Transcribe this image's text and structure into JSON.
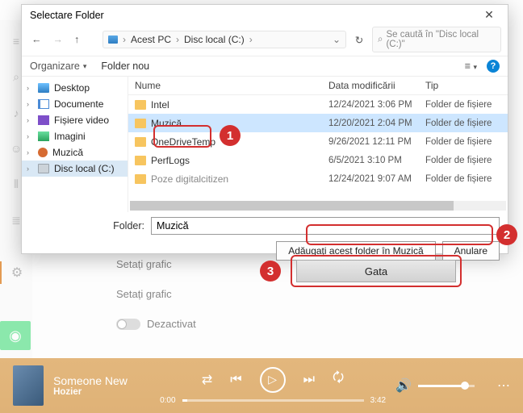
{
  "dialog": {
    "title": "Selectare Folder",
    "nav": {
      "path": {
        "seg1": "Acest PC",
        "seg2": "Disc local (C:)"
      },
      "search_placeholder": "Se caută în \"Disc local (C:)\""
    },
    "toolbar": {
      "organize": "Organizare",
      "newfolder": "Folder nou"
    },
    "tree": {
      "desktop": "Desktop",
      "documents": "Documente",
      "video": "Fișiere video",
      "images": "Imagini",
      "music": "Muzică",
      "disk": "Disc local (C:)"
    },
    "columns": {
      "name": "Nume",
      "date": "Data modificării",
      "type": "Tip"
    },
    "rows": [
      {
        "name": "Intel",
        "date": "12/24/2021 3:06 PM",
        "type": "Folder de fișiere",
        "sel": false,
        "cut": false
      },
      {
        "name": "Muzică",
        "date": "12/20/2021 2:04 PM",
        "type": "Folder de fișiere",
        "sel": true,
        "cut": false
      },
      {
        "name": "OneDriveTemp",
        "date": "9/26/2021 12:11 PM",
        "type": "Folder de fișiere",
        "sel": false,
        "cut": false
      },
      {
        "name": "PerfLogs",
        "date": "6/5/2021 3:10 PM",
        "type": "Folder de fișiere",
        "sel": false,
        "cut": false
      },
      {
        "name": "Poze digitalcitizen",
        "date": "12/24/2021 9:07 AM",
        "type": "Folder de fișiere",
        "sel": false,
        "cut": true
      }
    ],
    "folder_label": "Folder:",
    "folder_value": "Muzică",
    "add_button": "Adăugați acest folder în Muzică",
    "cancel_button": "Anulare"
  },
  "settings": {
    "row1": "Setați grafic",
    "row2": "Setați grafic",
    "off": "Dezactivat"
  },
  "done_button": "Gata",
  "annotations": {
    "n1": "1",
    "n2": "2",
    "n3": "3"
  },
  "media": {
    "title": "Someone New",
    "artist": "Hozier",
    "elapsed": "0:00",
    "total": "3:42"
  }
}
